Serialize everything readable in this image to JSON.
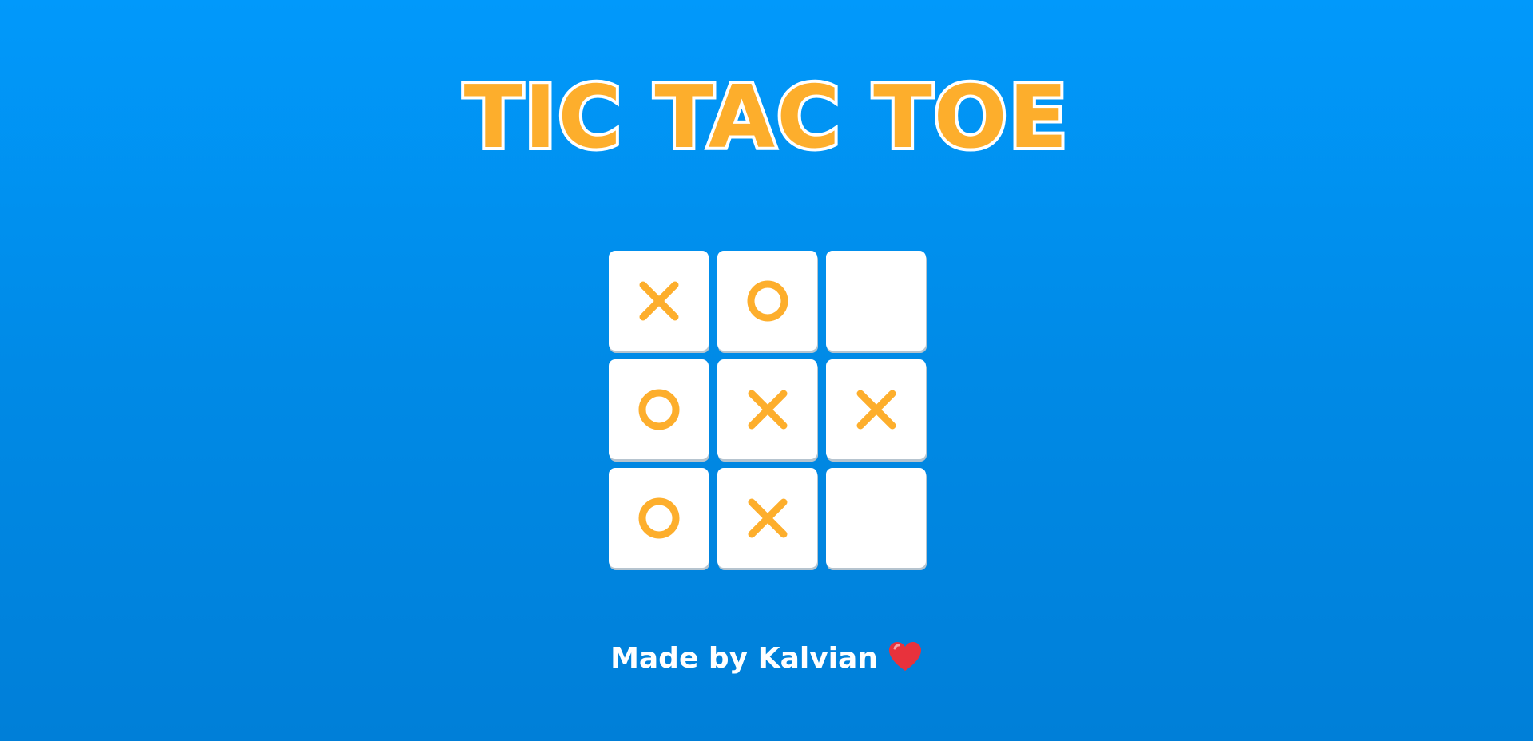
{
  "title": "TIC TAC TOE",
  "board": {
    "cells": [
      "X",
      "O",
      "",
      "O",
      "X",
      "X",
      "O",
      "X",
      ""
    ]
  },
  "footer": {
    "text": "Made by Kalvian",
    "heart_icon": "heart-icon"
  },
  "colors": {
    "background_top": "#0199fb",
    "background_bottom": "#007fd8",
    "accent": "#fdae2c",
    "cell": "#ffffff",
    "heart": "#e8323c"
  }
}
